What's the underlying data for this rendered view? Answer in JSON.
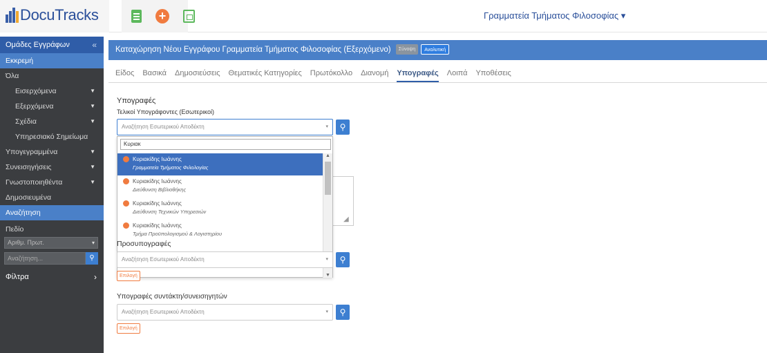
{
  "app": {
    "name": "DocuTracks"
  },
  "header": {
    "user_menu": "Γραμματεία Τμήματος Φιλοσοφίας ▾"
  },
  "sidebar": {
    "groups_title": "Ομάδες Εγγράφων",
    "collapse_icon": "«",
    "pending": "Εκκρεμή",
    "items": [
      {
        "label": "Όλα"
      },
      {
        "label": "Εισερχόμενα"
      },
      {
        "label": "Εξερχόμενα"
      },
      {
        "label": "Σχέδια"
      },
      {
        "label": "Υπηρεσιακό Σημείωμα"
      },
      {
        "label": "Υπογεγραμμένα"
      },
      {
        "label": "Συνεισηγήσεις"
      },
      {
        "label": "Γνωστοποιηθέντα"
      },
      {
        "label": "Δημοσιευμένα"
      }
    ],
    "search_title": "Αναζήτηση",
    "field_label": "Πεδίο",
    "field_value": "Αριθμ. Πρωτ.",
    "search_placeholder": "Αναζήτηση...",
    "filters_title": "Φίλτρα",
    "filters_chevron": "›"
  },
  "main": {
    "title": "Καταχώρηση Νέου Εγγράφου Γραμματεία Τμήματος Φιλοσοφίας (Εξερχόμενο)",
    "pill_summary": "Σύνοψη",
    "pill_detail": "Αναλυτική",
    "tabs": [
      {
        "label": "Είδος"
      },
      {
        "label": "Βασικά"
      },
      {
        "label": "Δημοσιεύσεις"
      },
      {
        "label": "Θεματικές Κατηγορίες"
      },
      {
        "label": "Πρωτόκολλο"
      },
      {
        "label": "Διανομή"
      },
      {
        "label": "Υπογραφές"
      },
      {
        "label": "Λοιπά"
      },
      {
        "label": "Υποθέσεις"
      }
    ],
    "signatures_title": "Υπογραφές",
    "final_signers_label": "Τελικοί Υπογράφοντες (Εσωτερικοί)",
    "recipient_placeholder": "Αναζήτηση Εσωτερικού Αποδέκτη",
    "dropdown": {
      "query": "Κυριακ",
      "items": [
        {
          "name": "Κυριακίδης Ιωάννης",
          "org": "Γραμματεία Τμήματος Φιλολογίας"
        },
        {
          "name": "Κυριακίδης Ιωάννης",
          "org": "Διεύθυνση Βιβλιοθήκης"
        },
        {
          "name": "Κυριακίδης Ιωάννης",
          "org": "Διεύθυνση Τεχνικών Υπηρεσιών"
        },
        {
          "name": "Κυριακίδης Ιωάννης",
          "org": "Τμήμα Προϋπολογισμού & Λογιστηρίου"
        }
      ]
    },
    "pre_signatures_title": "Προσυπογραφές",
    "choose_label": "Επιλογή",
    "author_signatures_title": "Υπογραφές συντάκτη/συνεισηγητών"
  },
  "colors": {
    "brand_blue": "#2f5da8",
    "title_bar": "#4a80c8",
    "accent_orange": "#f07b3f",
    "sidebar_dark": "#3b3d40"
  },
  "icons": [
    "logo-bars-icon",
    "document-icon",
    "add-circle-icon",
    "copy-document-icon",
    "caret-down-icon",
    "search-icon",
    "chevron-right-icon",
    "double-chevron-left-icon"
  ]
}
